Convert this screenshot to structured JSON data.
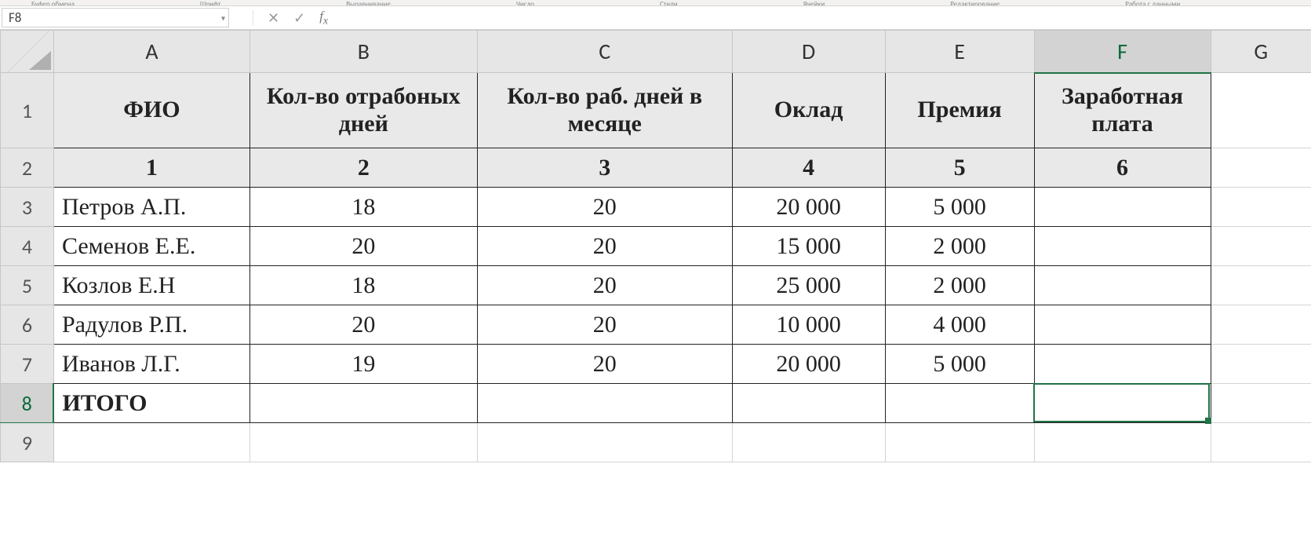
{
  "ribbon": {
    "groups": [
      "Буфер обмена",
      "Шрифт",
      "Выравнивание",
      "Число",
      "Стили",
      "Ячейки",
      "Редактирование",
      "Работа с данными"
    ]
  },
  "formulaBar": {
    "nameBox": "F8",
    "formula": ""
  },
  "columns": [
    "A",
    "B",
    "C",
    "D",
    "E",
    "F",
    "G"
  ],
  "rows": [
    "1",
    "2",
    "3",
    "4",
    "5",
    "6",
    "7",
    "8",
    "9"
  ],
  "selectedCell": "F8",
  "table": {
    "headers": {
      "A": "ФИО",
      "B": "Кол-во отрабоных дней",
      "C": "Кол-во раб. дней в месяце",
      "D": "Оклад",
      "E": "Премия",
      "F": "Заработная плата"
    },
    "colNums": {
      "A": "1",
      "B": "2",
      "C": "3",
      "D": "4",
      "E": "5",
      "F": "6"
    },
    "rows": [
      {
        "fio": "Петров А.П.",
        "worked": "18",
        "month": "20",
        "salary": "20 000",
        "bonus": "5 000",
        "pay": ""
      },
      {
        "fio": "Семенов Е.Е.",
        "worked": "20",
        "month": "20",
        "salary": "15 000",
        "bonus": "2 000",
        "pay": ""
      },
      {
        "fio": "Козлов Е.Н",
        "worked": "18",
        "month": "20",
        "salary": "25 000",
        "bonus": "2 000",
        "pay": ""
      },
      {
        "fio": "Радулов Р.П.",
        "worked": "20",
        "month": "20",
        "salary": "10 000",
        "bonus": "4 000",
        "pay": ""
      },
      {
        "fio": "Иванов Л.Г.",
        "worked": "19",
        "month": "20",
        "salary": "20 000",
        "bonus": "5 000",
        "pay": ""
      }
    ],
    "totalLabel": "ИТОГО"
  }
}
